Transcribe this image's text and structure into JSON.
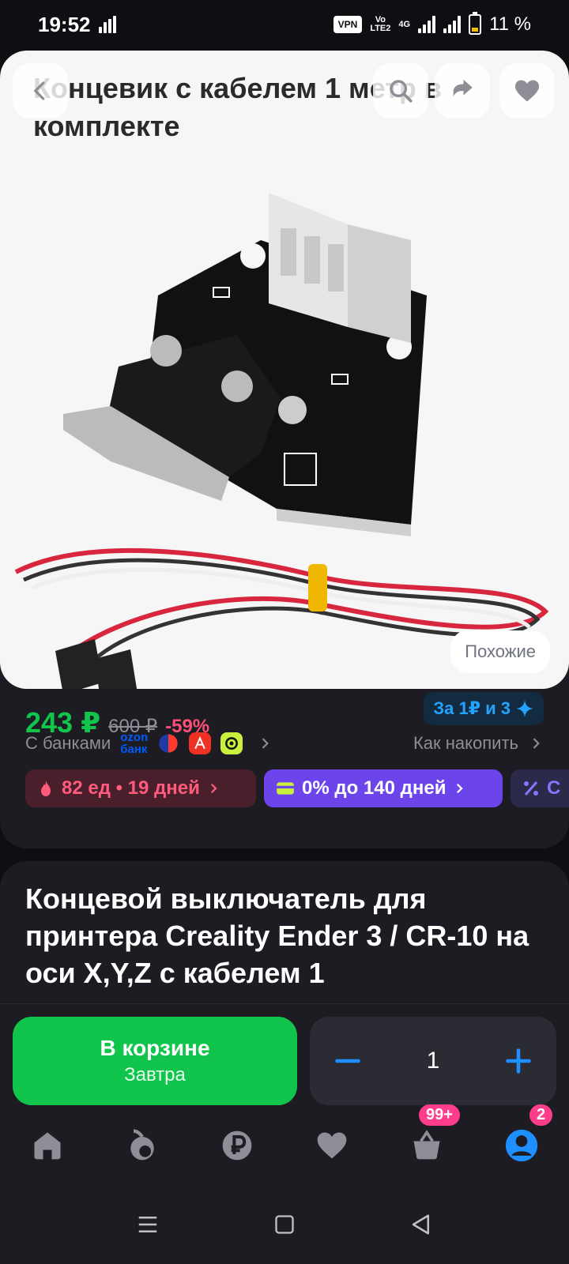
{
  "status_bar": {
    "time": "19:52",
    "vpn": "VPN",
    "volte_top": "Vo",
    "volte_bottom": "LTE2",
    "net": "4G",
    "battery": "11 %"
  },
  "gallery": {
    "image_caption": "Концевик с кабелем 1 метр в комплекте",
    "similar_label": "Похожие",
    "icons": [
      "back-icon",
      "search-icon",
      "share-icon",
      "heart-icon"
    ]
  },
  "price": {
    "current": "243 ₽",
    "old": "600 ₽",
    "discount": "-59%",
    "bonus_label": "За 1₽ и 3"
  },
  "banks": {
    "label": "С банками",
    "ozon_top": "ozon",
    "ozon_bottom": "банк",
    "accumulate": "Как накопить"
  },
  "chips": {
    "fire": "82 ед • 19 дней",
    "credit": "0% до 140 дней",
    "pct": "С"
  },
  "product": {
    "title": "Концевой выключатель для принтера Creality Ender 3 / CR-10 на оси X,Y,Z с кабелем 1"
  },
  "actions": {
    "cart_label": "В корзине",
    "cart_sub": "Завтра",
    "quantity": "1"
  },
  "bottom_nav": {
    "cart_badge": "99+",
    "profile_badge": "2",
    "items": [
      "home-icon",
      "fresh-icon",
      "ruble-icon",
      "favorites-icon",
      "cart-icon",
      "profile-icon"
    ]
  },
  "colors": {
    "accent_green": "#10c44c",
    "discount_pink": "#ff4f74",
    "bonus_blue": "#23a3ff",
    "badge_pink": "#ff3d8b",
    "profile_blue": "#1e8fff",
    "background": "#1c1c22"
  }
}
